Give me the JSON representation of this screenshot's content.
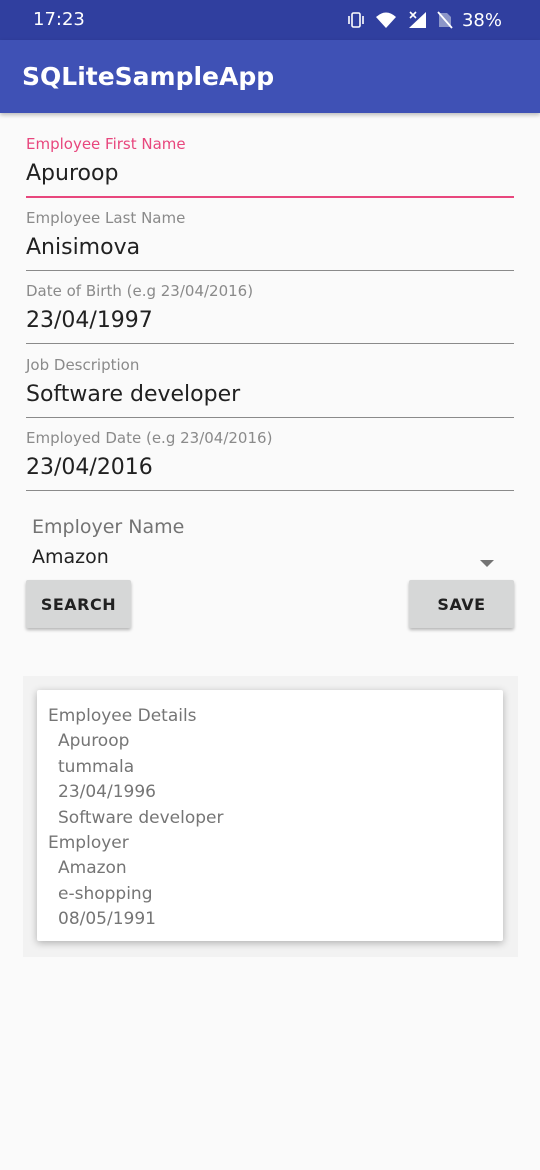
{
  "status_bar": {
    "time": "17:23",
    "battery": "38%",
    "icons": [
      "vibrate-icon",
      "wifi-icon",
      "cell-signal-icon",
      "no-sim-icon"
    ]
  },
  "app_bar": {
    "title": "SQLiteSampleApp",
    "color": "#3f51b5"
  },
  "form": {
    "first_name": {
      "label": "Employee First Name",
      "value": "Apuroop"
    },
    "last_name": {
      "label": "Employee Last Name",
      "value": "Anisimova"
    },
    "dob": {
      "label": "Date of Birth (e.g 23/04/2016)",
      "value": "23/04/1997"
    },
    "job": {
      "label": "Job Description",
      "value": "Software developer"
    },
    "employed_date": {
      "label": "Employed Date (e.g 23/04/2016)",
      "value": "23/04/2016"
    },
    "employer": {
      "label": "Employer Name",
      "selected": "Amazon"
    },
    "accent_color": "#e8467d"
  },
  "buttons": {
    "search": "SEARCH",
    "save": "SAVE"
  },
  "results": {
    "employee_header": "Employee Details",
    "employee": [
      "Apuroop",
      "tummala",
      "23/04/1996",
      "Software developer"
    ],
    "employer_header": "Employer",
    "employer": [
      "Amazon",
      "e-shopping",
      "08/05/1991"
    ]
  }
}
